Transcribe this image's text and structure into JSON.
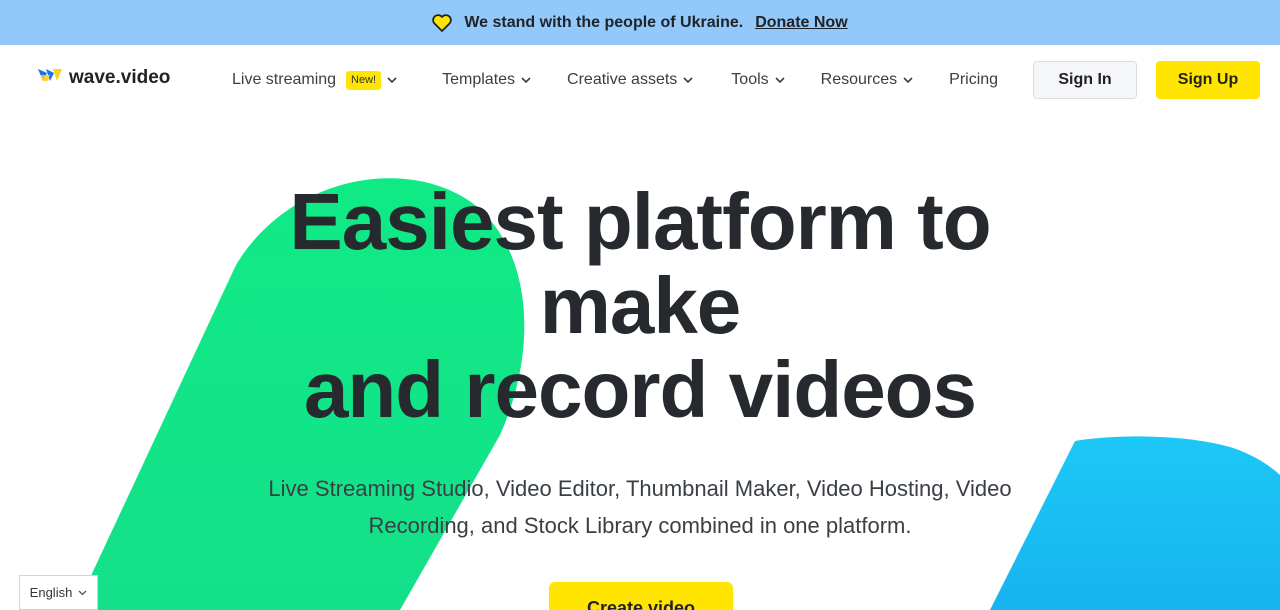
{
  "banner": {
    "message": "We stand with the people of Ukraine.",
    "donate_label": "Donate Now",
    "background": "#93c8fb"
  },
  "brand": {
    "name": "wave.video",
    "accent_yellow": "#ffe500",
    "accent_green": "#12e886",
    "accent_blue": "#19bff2"
  },
  "nav": {
    "items": [
      {
        "label": "Live streaming",
        "badge": "New!",
        "dropdown": true
      },
      {
        "label": "Templates",
        "dropdown": true
      },
      {
        "label": "Creative assets",
        "dropdown": true
      },
      {
        "label": "Tools",
        "dropdown": true
      },
      {
        "label": "Resources",
        "dropdown": true
      },
      {
        "label": "Pricing",
        "dropdown": false
      }
    ],
    "sign_in_label": "Sign In",
    "sign_up_label": "Sign Up"
  },
  "hero": {
    "headline_line1": "Easiest platform to",
    "headline_line2": "make",
    "headline_line3": "and record videos",
    "subtext_line1": "Live Streaming Studio, Video Editor, Thumbnail Maker, Video Hosting, Video",
    "subtext_line2": "Recording, and Stock Library combined in one platform.",
    "cta_label": "Create video"
  },
  "language": {
    "selected": "English"
  }
}
